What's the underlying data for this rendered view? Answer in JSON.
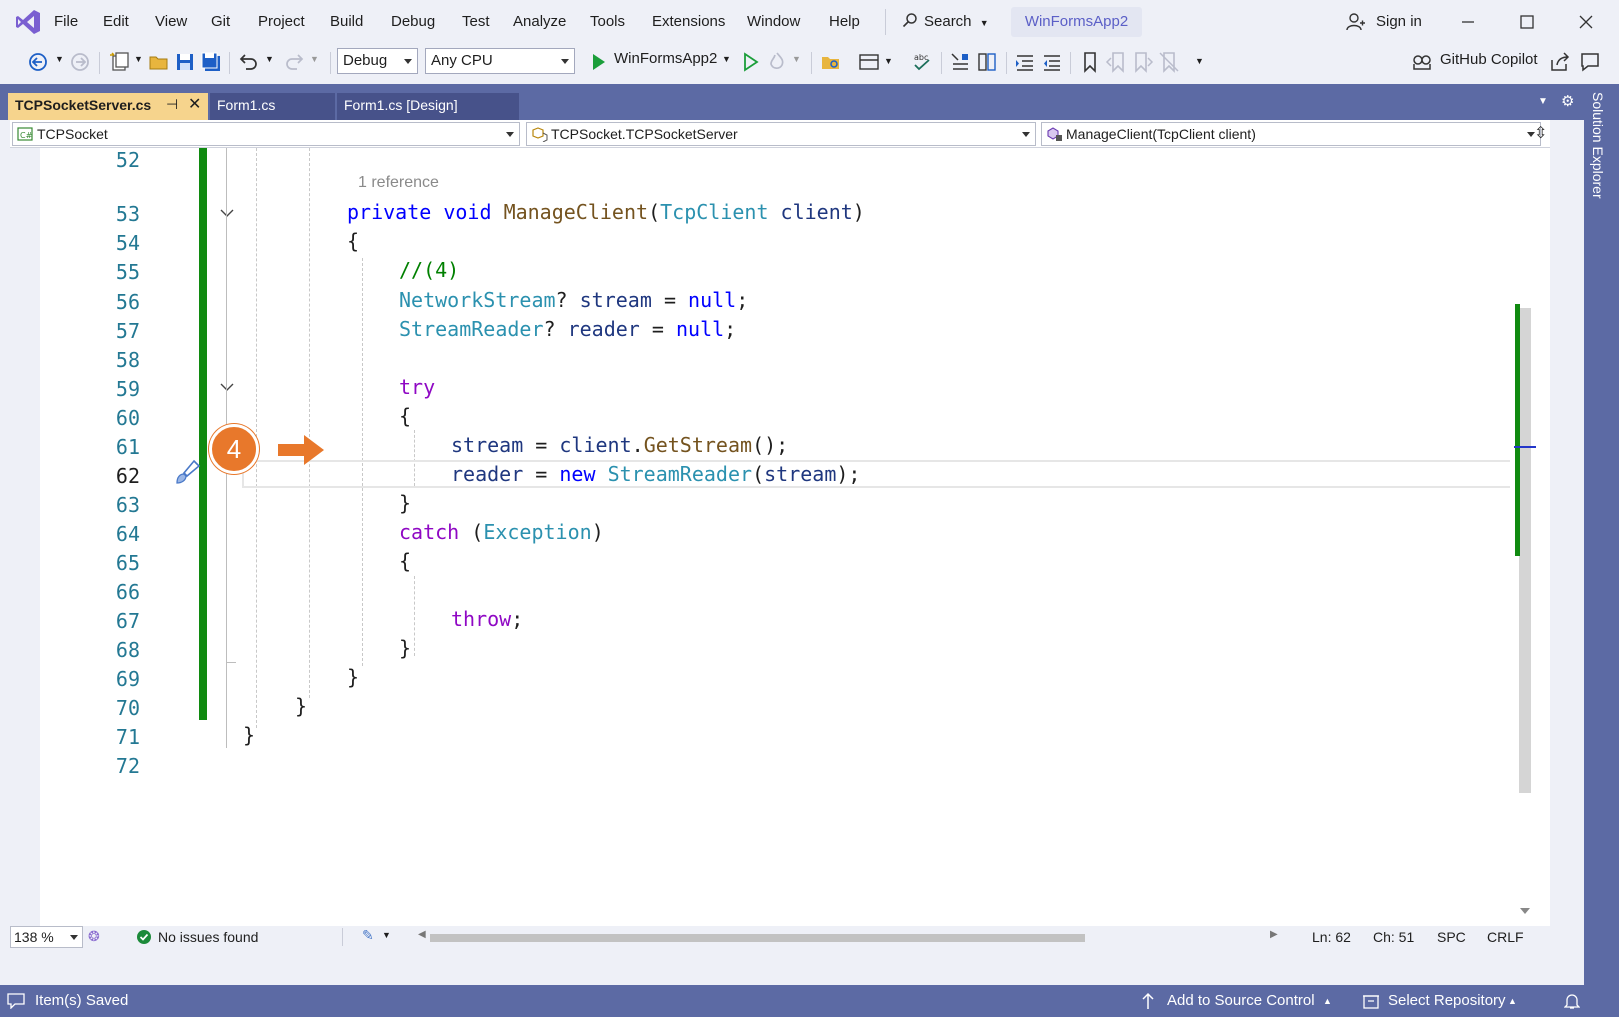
{
  "menubar": {
    "items": [
      "File",
      "Edit",
      "View",
      "Git",
      "Project",
      "Build",
      "Debug",
      "Test",
      "Analyze",
      "Tools",
      "Extensions",
      "Window",
      "Help"
    ],
    "search_label": "Search",
    "project_name": "WinFormsApp2",
    "signin_label": "Sign in"
  },
  "toolbar": {
    "configuration": "Debug",
    "platform": "Any CPU",
    "run_target": "WinFormsApp2",
    "copilot_label": "GitHub Copilot"
  },
  "tabs": [
    {
      "label": "TCPSocketServer.cs",
      "active": true
    },
    {
      "label": "Form1.cs",
      "active": false
    },
    {
      "label": "Form1.cs [Design]",
      "active": false
    }
  ],
  "navbar": {
    "project": "TCPSocket",
    "type": "TCPSocket.TCPSocketServer",
    "member": "ManageClient(TcpClient client)"
  },
  "editor": {
    "codelens": "1 reference",
    "line_numbers": [
      "52",
      "53",
      "54",
      "55",
      "56",
      "57",
      "58",
      "59",
      "60",
      "61",
      "62",
      "63",
      "64",
      "65",
      "66",
      "67",
      "68",
      "69",
      "70",
      "71",
      "72"
    ],
    "current_line": "62",
    "badge": "4",
    "code": {
      "l53_kw1": "private",
      "l53_kw2": "void",
      "l53_fn": "ManageClient",
      "l53_p1": "(",
      "l53_ty": "TcpClient",
      "l53_id": "client",
      "l53_p2": ")",
      "l54": "{",
      "l55": "//(4)",
      "l56_ty": "NetworkStream",
      "l56_q": "?",
      "l56_id": "stream",
      "l56_eq": "=",
      "l56_kw": "null",
      "l56_end": ";",
      "l57_ty": "StreamReader",
      "l57_q": "?",
      "l57_id": "reader",
      "l57_eq": "=",
      "l57_kw": "null",
      "l57_end": ";",
      "l59": "try",
      "l60": "{",
      "l61_id1": "stream",
      "l61_eq": "=",
      "l61_id2": "client",
      "l61_dot": ".",
      "l61_fn": "GetStream",
      "l61_end": "();",
      "l62_id1": "reader",
      "l62_eq": "=",
      "l62_kw": "new",
      "l62_ty": "StreamReader",
      "l62_p1": "(",
      "l62_id2": "stream",
      "l62_end": ");",
      "l63": "}",
      "l64_kw": "catch",
      "l64_p1": "(",
      "l64_ty": "Exception",
      "l64_p2": ")",
      "l65": "{",
      "l67_kw": "throw",
      "l67_end": ";",
      "l68": "}",
      "l69": "}",
      "l70": "}",
      "l71": "}"
    }
  },
  "editor_status": {
    "zoom": "138 %",
    "issues": "No issues found",
    "line": "Ln: 62",
    "column": "Ch: 51",
    "whitespace": "SPC",
    "line_ending": "CRLF"
  },
  "statusbar": {
    "message": "Item(s) Saved",
    "source_control": "Add to Source Control",
    "repository": "Select Repository"
  },
  "right_rail": {
    "label": "Solution Explorer"
  },
  "colors": {
    "accent": "#5c6aa4",
    "active_tab": "#f6d48d",
    "change_bar": "#108a10",
    "badge": "#e8782b",
    "keyword": "#0000ff",
    "control_keyword": "#8f08c4",
    "type": "#2b91af",
    "method": "#74531f",
    "comment": "#008000"
  }
}
